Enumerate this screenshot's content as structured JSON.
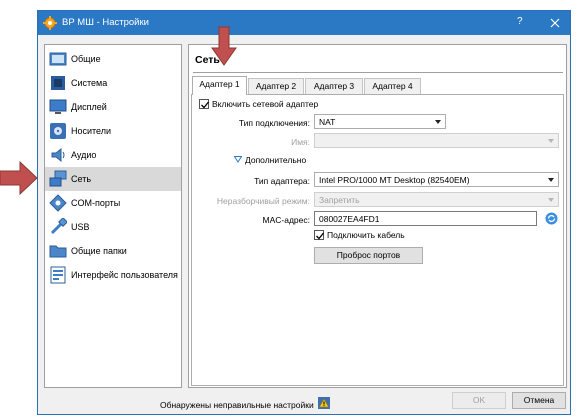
{
  "window": {
    "title": "ВР МШ - Настройки",
    "help_label": "?"
  },
  "sidebar": {
    "items": [
      {
        "label": "Общие",
        "icon": "general-settings-icon"
      },
      {
        "label": "Система",
        "icon": "motherboard-icon"
      },
      {
        "label": "Дисплей",
        "icon": "monitor-icon"
      },
      {
        "label": "Носители",
        "icon": "storage-disk-icon"
      },
      {
        "label": "Аудио",
        "icon": "speaker-icon"
      },
      {
        "label": "Сеть",
        "icon": "network-icon",
        "selected": true
      },
      {
        "label": "COM-порты",
        "icon": "serial-port-icon"
      },
      {
        "label": "USB",
        "icon": "usb-icon"
      },
      {
        "label": "Общие папки",
        "icon": "shared-folder-icon"
      },
      {
        "label": "Интерфейс пользователя",
        "icon": "user-interface-icon"
      }
    ]
  },
  "page": {
    "title": "Сеть",
    "tabs": [
      {
        "label": "Адаптер 1",
        "active": true
      },
      {
        "label": "Адаптер 2"
      },
      {
        "label": "Адаптер 3"
      },
      {
        "label": "Адаптер 4"
      }
    ],
    "enable_adapter": {
      "label": "Включить сетевой адаптер",
      "checked": true
    },
    "attachment": {
      "label": "Тип подключения:",
      "value": "NAT"
    },
    "name": {
      "label": "Имя:",
      "value": ""
    },
    "advanced_label": "Дополнительно",
    "adapter_type": {
      "label": "Тип адаптера:",
      "value": "Intel PRO/1000 MT Desktop (82540EM)"
    },
    "promiscuous": {
      "label": "Неразборчивый режим:",
      "value": "Запретить"
    },
    "mac": {
      "label": "MAC-адрес:",
      "value": "080027EA4FD1"
    },
    "cable": {
      "label": "Подключить кабель",
      "checked": true
    },
    "port_forwarding_label": "Проброс портов"
  },
  "footer": {
    "status": "Обнаружены неправильные настройки",
    "ok_label": "OK",
    "cancel_label": "Отмена"
  },
  "colors": {
    "titlebar": "#2b79c5",
    "annotation_arrow": "#c0504d",
    "selected_item": "#d9d9d9"
  }
}
